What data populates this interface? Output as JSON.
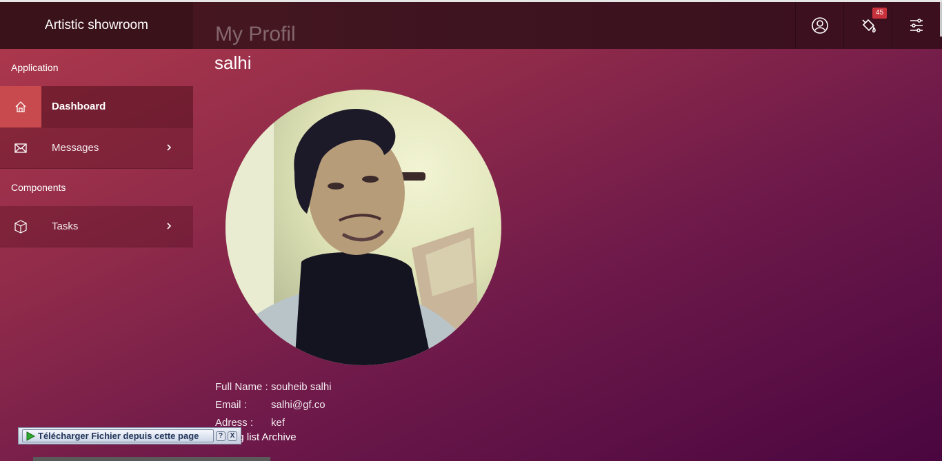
{
  "app": {
    "brand": "Artistic showroom",
    "page_title": "My Profil"
  },
  "header": {
    "notification_count": "45",
    "icons": [
      "user-icon",
      "paint-bucket-icon",
      "settings-sliders-icon"
    ]
  },
  "sidebar": {
    "sections": [
      {
        "label": "Application"
      },
      {
        "label": "Components"
      }
    ],
    "items": [
      {
        "label": "Dashboard",
        "icon": "home-icon",
        "active": true
      },
      {
        "label": "Messages",
        "icon": "envelope-icon",
        "has_submenu": true
      },
      {
        "label": "Tasks",
        "icon": "cube-icon",
        "has_submenu": true
      }
    ]
  },
  "profile": {
    "username": "salhi",
    "fields": [
      {
        "key": "Full Name :",
        "value": "souheib salhi"
      },
      {
        "key": "Email :",
        "value": "salhi@gf.co"
      },
      {
        "key": "Adress :",
        "value": "kef"
      }
    ],
    "archive_text": "Voting list Archive"
  },
  "download_bar": {
    "label": "Télécharger Fichier depuis cette page",
    "help": "?",
    "close": "X"
  },
  "colors": {
    "accent": "#c84a4e",
    "badge": "#c8323c"
  }
}
